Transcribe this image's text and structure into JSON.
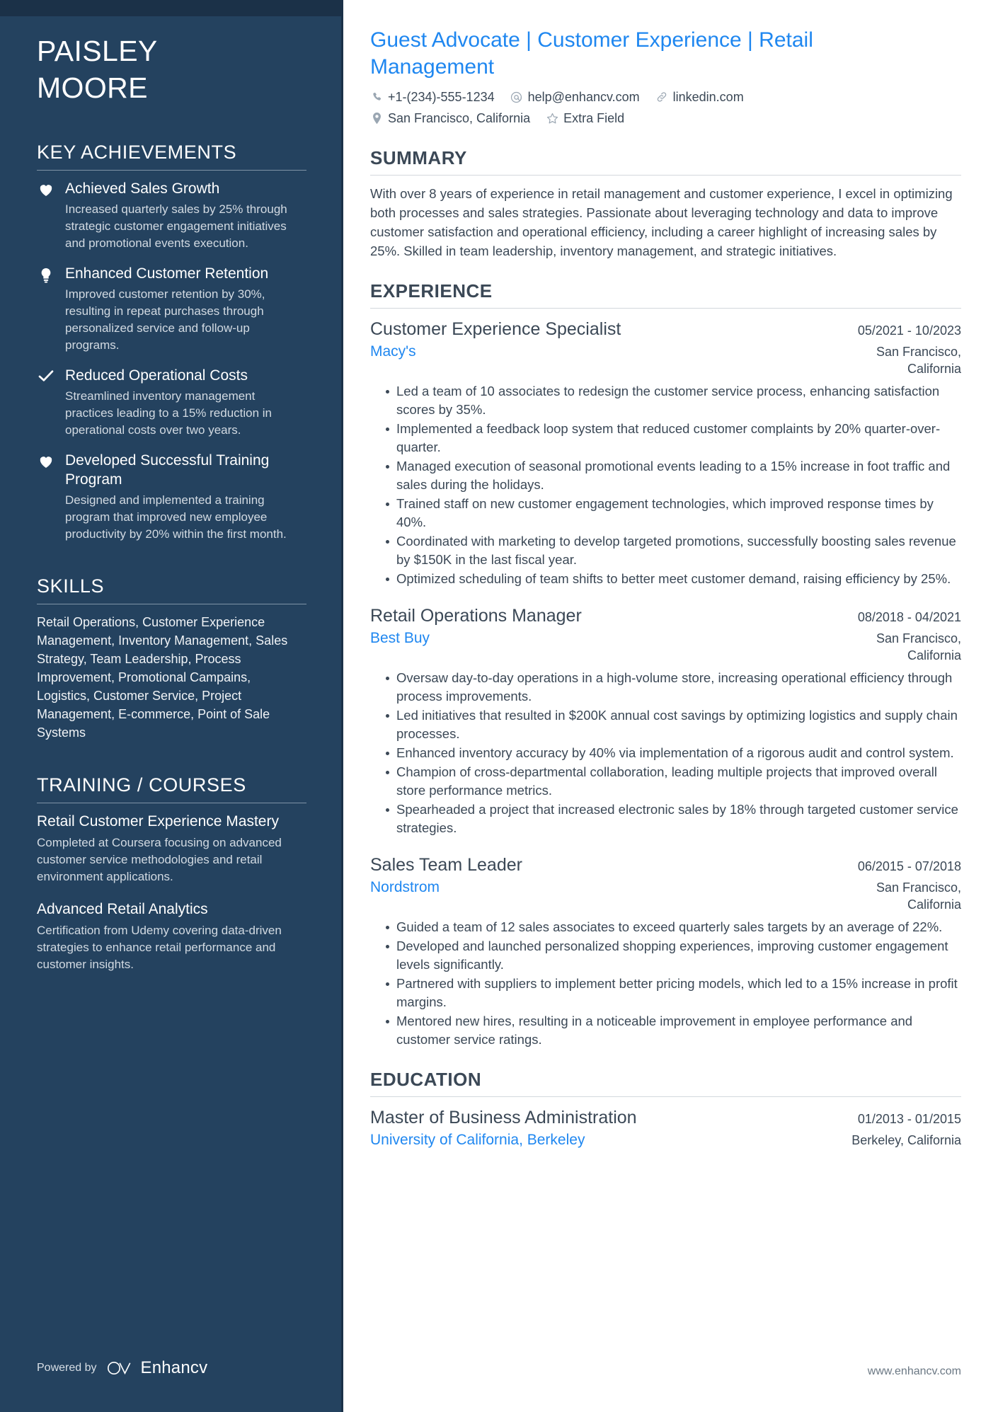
{
  "sidebar": {
    "name_first": "PAISLEY",
    "name_last": "MOORE",
    "achievements_heading": "KEY ACHIEVEMENTS",
    "achievements": [
      {
        "icon": "heart-icon",
        "title": "Achieved Sales Growth",
        "description": "Increased quarterly sales by 25% through strategic customer engagement initiatives and promotional events execution."
      },
      {
        "icon": "lightbulb-icon",
        "title": "Enhanced Customer Retention",
        "description": "Improved customer retention by 30%, resulting in repeat purchases through personalized service and follow-up programs."
      },
      {
        "icon": "check-icon",
        "title": "Reduced Operational Costs",
        "description": "Streamlined inventory management practices leading to a 15% reduction in operational costs over two years."
      },
      {
        "icon": "heart-icon",
        "title": "Developed Successful Training Program",
        "description": "Designed and implemented a training program that improved new employee productivity by 20% within the first month."
      }
    ],
    "skills_heading": "SKILLS",
    "skills_text": "Retail Operations, Customer Experience Management, Inventory Management, Sales Strategy, Team Leadership, Process Improvement, Promotional Campains, Logistics, Customer Service, Project Management, E-commerce, Point of Sale Systems",
    "training_heading": "TRAINING / COURSES",
    "courses": [
      {
        "title": "Retail Customer Experience Mastery",
        "description": "Completed at Coursera focusing on advanced customer service methodologies and retail environment applications."
      },
      {
        "title": "Advanced Retail Analytics",
        "description": "Certification from Udemy covering data-driven strategies to enhance retail performance and customer insights."
      }
    ],
    "powered_by": "Powered by",
    "brand": "Enhancv"
  },
  "header": {
    "headline": "Guest Advocate | Customer Experience | Retail Management",
    "contacts_row1": [
      {
        "icon": "phone-icon",
        "text": "+1-(234)-555-1234"
      },
      {
        "icon": "email-icon",
        "text": "help@enhancv.com"
      },
      {
        "icon": "link-icon",
        "text": "linkedin.com"
      }
    ],
    "contacts_row2": [
      {
        "icon": "location-pin-icon",
        "text": "San Francisco, California"
      },
      {
        "icon": "star-icon",
        "text": "Extra Field"
      }
    ]
  },
  "summary": {
    "heading": "SUMMARY",
    "text": "With over 8 years of experience in retail management and customer experience, I excel in optimizing both processes and sales strategies. Passionate about leveraging technology and data to improve customer satisfaction and operational efficiency, including a career highlight of increasing sales by 25%. Skilled in team leadership, inventory management, and strategic initiatives."
  },
  "experience": {
    "heading": "EXPERIENCE",
    "jobs": [
      {
        "title": "Customer Experience Specialist",
        "dates": "05/2021 - 10/2023",
        "company": "Macy's",
        "location": "San Francisco, California",
        "bullets": [
          "Led a team of 10 associates to redesign the customer service process, enhancing satisfaction scores by 35%.",
          "Implemented a feedback loop system that reduced customer complaints by 20% quarter-over-quarter.",
          "Managed execution of seasonal promotional events leading to a 15% increase in foot traffic and sales during the holidays.",
          "Trained staff on new customer engagement technologies, which improved response times by 40%.",
          "Coordinated with marketing to develop targeted promotions, successfully boosting sales revenue by $150K in the last fiscal year.",
          "Optimized scheduling of team shifts to better meet customer demand, raising efficiency by 25%."
        ]
      },
      {
        "title": "Retail Operations Manager",
        "dates": "08/2018 - 04/2021",
        "company": "Best Buy",
        "location": "San Francisco, California",
        "bullets": [
          "Oversaw day-to-day operations in a high-volume store, increasing operational efficiency through process improvements.",
          "Led initiatives that resulted in $200K annual cost savings by optimizing logistics and supply chain processes.",
          "Enhanced inventory accuracy by 40% via implementation of a rigorous audit and control system.",
          "Champion of cross-departmental collaboration, leading multiple projects that improved overall store performance metrics.",
          "Spearheaded a project that increased electronic sales by 18% through targeted customer service strategies."
        ]
      },
      {
        "title": "Sales Team Leader",
        "dates": "06/2015 - 07/2018",
        "company": "Nordstrom",
        "location": "San Francisco, California",
        "bullets": [
          "Guided a team of 12 sales associates to exceed quarterly sales targets by an average of 22%.",
          "Developed and launched personalized shopping experiences, improving customer engagement levels significantly.",
          "Partnered with suppliers to implement better pricing models, which led to a 15% increase in profit margins.",
          "Mentored new hires, resulting in a noticeable improvement in employee performance and customer service ratings."
        ]
      }
    ]
  },
  "education": {
    "heading": "EDUCATION",
    "entries": [
      {
        "degree": "Master of Business Administration",
        "dates": "01/2013 - 01/2015",
        "school": "University of California, Berkeley",
        "location": "Berkeley, California"
      }
    ]
  },
  "footer": {
    "website": "www.enhancv.com"
  },
  "colors": {
    "sidebar_bg": "#24425f",
    "sidebar_band": "#1b3148",
    "accent_blue": "#1f87f0",
    "body_text": "#3b4856"
  }
}
